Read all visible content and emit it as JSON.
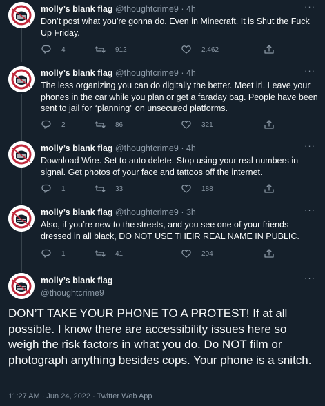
{
  "replies": [
    {
      "name": "molly’s blank flag",
      "handle": "@thoughtcrime9",
      "time": "4h",
      "text": "Don’t post what you’re gonna do.  Even in Minecraft.  It is Shut the Fuck Up Friday.",
      "stats": {
        "replies": "4",
        "retweets": "912",
        "likes": "2,462"
      }
    },
    {
      "name": "molly’s blank flag",
      "handle": "@thoughtcrime9",
      "time": "4h",
      "text": "The less organizing you can do digitally the better.  Meet irl.  Leave your phones in the car while you plan or get a faraday bag.  People have been sent to jail for “planning” on unsecured platforms.",
      "stats": {
        "replies": "2",
        "retweets": "86",
        "likes": "321"
      }
    },
    {
      "name": "molly’s blank flag",
      "handle": "@thoughtcrime9",
      "time": "4h",
      "text": "Download Wire.  Set to auto delete.  Stop using your real numbers in signal.  Get photos of your face and tattoos off the internet.",
      "stats": {
        "replies": "1",
        "retweets": "33",
        "likes": "188"
      }
    },
    {
      "name": "molly’s blank flag",
      "handle": "@thoughtcrime9",
      "time": "3h",
      "text": "Also, if you’re new to the streets, and you see one of your friends dressed in all black, DO NOT USE THEIR REAL NAME IN PUBLIC.",
      "stats": {
        "replies": "1",
        "retweets": "41",
        "likes": "204"
      }
    }
  ],
  "main": {
    "name": "molly’s blank flag",
    "handle": "@thoughtcrime9",
    "text": "DON’T TAKE YOUR PHONE TO A PROTEST!  If at all possible.  I know there are accessibility issues here so weigh the risk factors in what you do.  Do NOT film or photograph anything besides cops.  Your phone is a snitch.",
    "meta": "11:27 AM · Jun 24, 2022 · Twitter Web App"
  },
  "separator": "·",
  "more_label": "···",
  "colors": {
    "background": "#15202b",
    "text": "#f7f9f9",
    "muted": "#8b98a5",
    "line": "#38444d",
    "avatar_red": "#c0283b"
  }
}
